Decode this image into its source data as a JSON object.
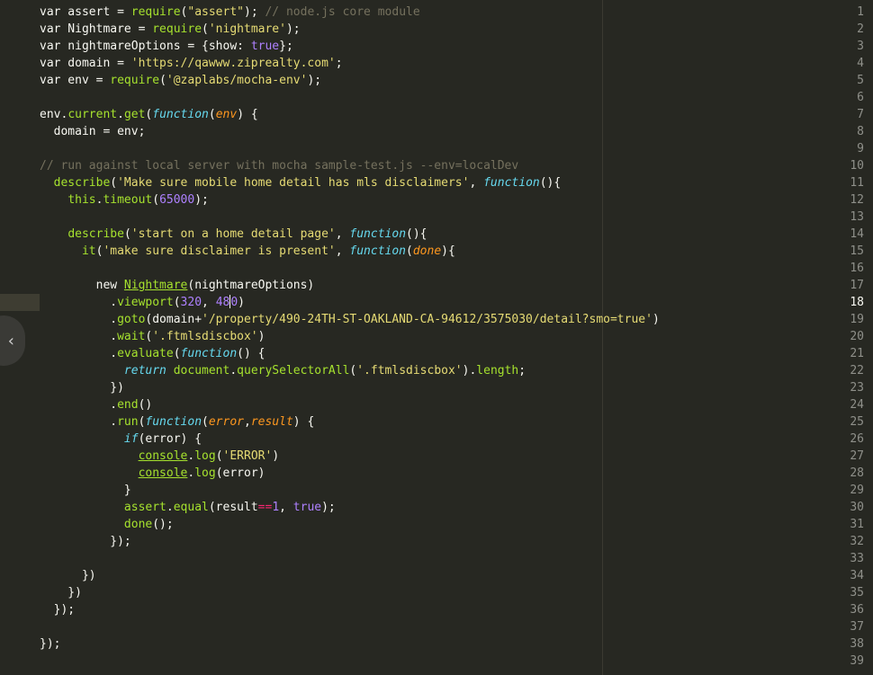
{
  "editor": {
    "active_line": 18,
    "line_numbers": [
      "1",
      "2",
      "3",
      "4",
      "5",
      "6",
      "7",
      "8",
      "9",
      "10",
      "11",
      "12",
      "13",
      "14",
      "15",
      "16",
      "17",
      "18",
      "19",
      "20",
      "21",
      "22",
      "23",
      "24",
      "25",
      "26",
      "27",
      "28",
      "29",
      "30",
      "31",
      "32",
      "33",
      "34",
      "35",
      "36",
      "37",
      "38",
      "39"
    ],
    "collapse_glyph": "‹",
    "lines": [
      [
        [
          "w",
          "var assert = "
        ],
        [
          "f",
          "require"
        ],
        [
          "w",
          "("
        ],
        [
          "s",
          "\"assert\""
        ],
        [
          "w",
          "); "
        ],
        [
          "c",
          "// node.js core module"
        ]
      ],
      [
        [
          "w",
          "var Nightmare = "
        ],
        [
          "f",
          "require"
        ],
        [
          "w",
          "("
        ],
        [
          "s",
          "'nightmare'"
        ],
        [
          "w",
          ");"
        ]
      ],
      [
        [
          "w",
          "var nightmareOptions = {show: "
        ],
        [
          "n",
          "true"
        ],
        [
          "w",
          "};"
        ]
      ],
      [
        [
          "w",
          "var domain = "
        ],
        [
          "s",
          "'https://qawww.ziprealty.com'"
        ],
        [
          "w",
          ";"
        ]
      ],
      [
        [
          "w",
          "var env = "
        ],
        [
          "f",
          "require"
        ],
        [
          "w",
          "("
        ],
        [
          "s",
          "'@zaplabs/mocha-env'"
        ],
        [
          "w",
          ");"
        ]
      ],
      [],
      [
        [
          "w",
          "env."
        ],
        [
          "f",
          "current"
        ],
        [
          "w",
          "."
        ],
        [
          "f",
          "get"
        ],
        [
          "w",
          "("
        ],
        [
          "k",
          "function"
        ],
        [
          "w",
          "("
        ],
        [
          "p",
          "env"
        ],
        [
          "w",
          ") {"
        ]
      ],
      [
        [
          "w",
          "  domain = env;"
        ]
      ],
      [],
      [
        [
          "c",
          "// run against local server with mocha sample-test.js --env=localDev"
        ]
      ],
      [
        [
          "w",
          "  "
        ],
        [
          "f",
          "describe"
        ],
        [
          "w",
          "("
        ],
        [
          "s",
          "'Make sure mobile home detail has mls disclaimers'"
        ],
        [
          "w",
          ", "
        ],
        [
          "k",
          "function"
        ],
        [
          "w",
          "(){"
        ]
      ],
      [
        [
          "w",
          "    "
        ],
        [
          "f",
          "this"
        ],
        [
          "w",
          "."
        ],
        [
          "f",
          "timeout"
        ],
        [
          "w",
          "("
        ],
        [
          "n",
          "65000"
        ],
        [
          "w",
          ");"
        ]
      ],
      [],
      [
        [
          "w",
          "    "
        ],
        [
          "f",
          "describe"
        ],
        [
          "w",
          "("
        ],
        [
          "s",
          "'start on a home detail page'"
        ],
        [
          "w",
          ", "
        ],
        [
          "k",
          "function"
        ],
        [
          "w",
          "(){"
        ]
      ],
      [
        [
          "w",
          "      "
        ],
        [
          "f",
          "it"
        ],
        [
          "w",
          "("
        ],
        [
          "s",
          "'make sure disclaimer is present'"
        ],
        [
          "w",
          ", "
        ],
        [
          "k",
          "function"
        ],
        [
          "w",
          "("
        ],
        [
          "p",
          "done"
        ],
        [
          "w",
          "){"
        ]
      ],
      [],
      [
        [
          "w",
          "        new "
        ],
        [
          "fu",
          "Nightmare"
        ],
        [
          "w",
          "(nightmareOptions)"
        ]
      ],
      [
        [
          "w",
          "          ."
        ],
        [
          "f",
          "viewport"
        ],
        [
          "w",
          "("
        ],
        [
          "n",
          "320"
        ],
        [
          "w",
          ", "
        ],
        [
          "n",
          "48"
        ],
        [
          "cur",
          ""
        ],
        [
          "n",
          "0"
        ],
        [
          "w",
          ")"
        ]
      ],
      [
        [
          "w",
          "          ."
        ],
        [
          "f",
          "goto"
        ],
        [
          "w",
          "(domain+"
        ],
        [
          "s",
          "'/property/490-24TH-ST-OAKLAND-CA-94612/3575030/detail?smo=true'"
        ],
        [
          "w",
          ")"
        ]
      ],
      [
        [
          "w",
          "          ."
        ],
        [
          "f",
          "wait"
        ],
        [
          "w",
          "("
        ],
        [
          "s",
          "'.ftmlsdiscbox'"
        ],
        [
          "w",
          ")"
        ]
      ],
      [
        [
          "w",
          "          ."
        ],
        [
          "f",
          "evaluate"
        ],
        [
          "w",
          "("
        ],
        [
          "k",
          "function"
        ],
        [
          "w",
          "() {"
        ]
      ],
      [
        [
          "w",
          "            "
        ],
        [
          "k",
          "return"
        ],
        [
          "w",
          " "
        ],
        [
          "f",
          "document"
        ],
        [
          "w",
          "."
        ],
        [
          "f",
          "querySelectorAll"
        ],
        [
          "w",
          "("
        ],
        [
          "s",
          "'.ftmlsdiscbox'"
        ],
        [
          "w",
          ")."
        ],
        [
          "f",
          "length"
        ],
        [
          "w",
          ";"
        ]
      ],
      [
        [
          "w",
          "          })"
        ]
      ],
      [
        [
          "w",
          "          ."
        ],
        [
          "f",
          "end"
        ],
        [
          "w",
          "()"
        ]
      ],
      [
        [
          "w",
          "          ."
        ],
        [
          "f",
          "run"
        ],
        [
          "w",
          "("
        ],
        [
          "k",
          "function"
        ],
        [
          "w",
          "("
        ],
        [
          "p",
          "error"
        ],
        [
          "w",
          ","
        ],
        [
          "p",
          "result"
        ],
        [
          "w",
          ") {"
        ]
      ],
      [
        [
          "w",
          "            "
        ],
        [
          "k",
          "if"
        ],
        [
          "w",
          "(error) {"
        ]
      ],
      [
        [
          "w",
          "              "
        ],
        [
          "fu",
          "console"
        ],
        [
          "w",
          "."
        ],
        [
          "f",
          "log"
        ],
        [
          "w",
          "("
        ],
        [
          "s",
          "'ERROR'"
        ],
        [
          "w",
          ")"
        ]
      ],
      [
        [
          "w",
          "              "
        ],
        [
          "fu",
          "console"
        ],
        [
          "w",
          "."
        ],
        [
          "f",
          "log"
        ],
        [
          "w",
          "(error)"
        ]
      ],
      [
        [
          "w",
          "            }"
        ]
      ],
      [
        [
          "w",
          "            "
        ],
        [
          "f",
          "assert"
        ],
        [
          "w",
          "."
        ],
        [
          "f",
          "equal"
        ],
        [
          "w",
          "(result"
        ],
        [
          "kw",
          "=="
        ],
        [
          "n",
          "1"
        ],
        [
          "w",
          ", "
        ],
        [
          "n",
          "true"
        ],
        [
          "w",
          ");"
        ]
      ],
      [
        [
          "w",
          "            "
        ],
        [
          "f",
          "done"
        ],
        [
          "w",
          "();"
        ]
      ],
      [
        [
          "w",
          "          });"
        ]
      ],
      [],
      [
        [
          "w",
          "      })"
        ]
      ],
      [
        [
          "w",
          "    })"
        ]
      ],
      [
        [
          "w",
          "  });"
        ]
      ],
      [],
      [
        [
          "w",
          "});"
        ]
      ],
      []
    ]
  }
}
